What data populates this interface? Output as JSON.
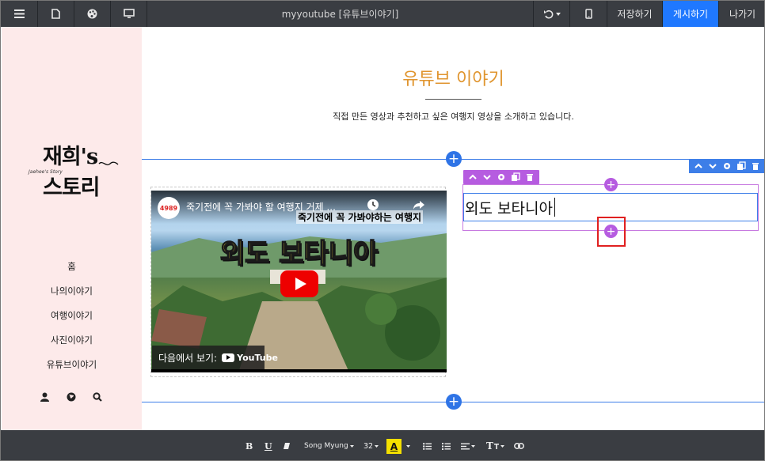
{
  "topbar": {
    "title": "myyoutube [유튜브이야기]",
    "save_label": "저장하기",
    "publish_label": "게시하기",
    "exit_label": "나가기"
  },
  "sidebar": {
    "logo_text": "재희's 스토리",
    "logo_small": "Jaehee's Story",
    "nav": [
      {
        "label": "홈"
      },
      {
        "label": "나의이야기"
      },
      {
        "label": "여행이야기"
      },
      {
        "label": "사진이야기"
      },
      {
        "label": "유튜브이야기"
      }
    ]
  },
  "header": {
    "title": "유튜브 이야기",
    "subtitle": "직접 만든 영상과 추천하고 싶은 여행지 영상을 소개하고 있습니다."
  },
  "video": {
    "channel_badge": "4989",
    "title": "죽기전에 꼭 가봐야 할 여행지 거제 ...",
    "overlay_text": "죽기전에 꼭 가봐야하는 여행지",
    "big_text": "외도 보타니아",
    "watch_on": "다음에서 보기:",
    "youtube": "YouTube"
  },
  "editor": {
    "text_content": "외도 보타니아"
  },
  "format_bar": {
    "bold": "B",
    "underline": "U",
    "font": "Song Myung",
    "size": "32",
    "highlight": "A",
    "text_style": "T"
  },
  "colors": {
    "accent": "#1f78ff",
    "title_orange": "#e0952f",
    "sidebar_bg": "#fdeaea",
    "selection_purple": "#b65ce0",
    "guide_blue": "#3d7ee8"
  }
}
